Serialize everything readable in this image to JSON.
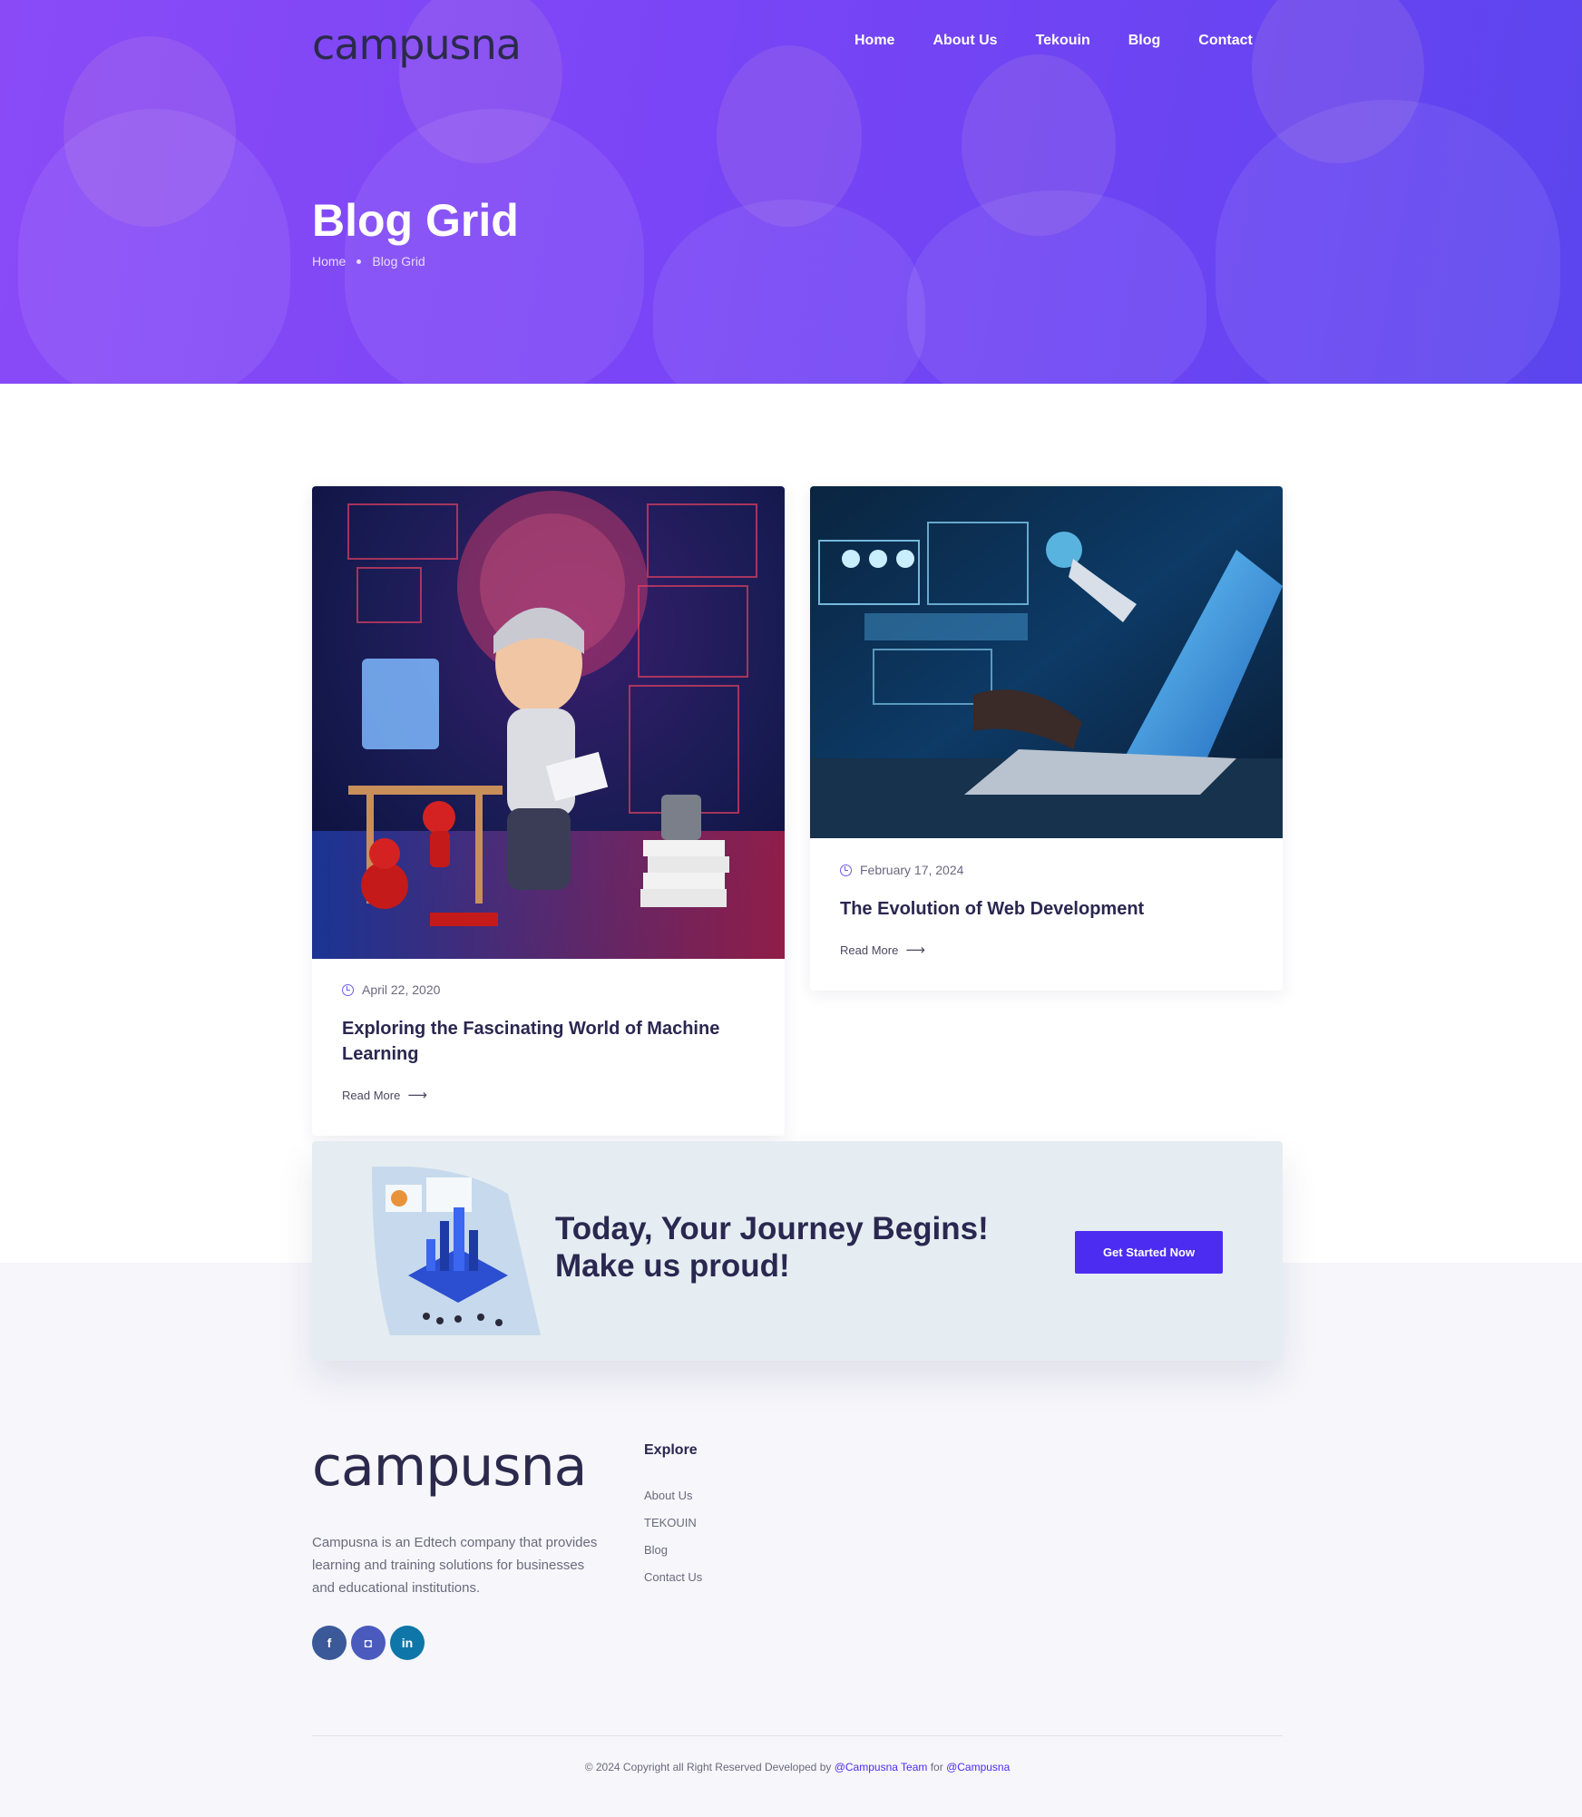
{
  "header": {
    "logo": "campusna",
    "nav": [
      "Home",
      "About Us",
      "Tekouin",
      "Blog",
      "Contact"
    ]
  },
  "hero": {
    "title": "Blog Grid",
    "breadcrumb": [
      "Home",
      "Blog Grid"
    ]
  },
  "posts": [
    {
      "date": "April 22, 2020",
      "title": "Exploring the Fascinating World of Machine Learning",
      "read_more": "Read More",
      "arrow": "⟶"
    },
    {
      "date": "February 17, 2024",
      "title": "The Evolution of Web Development",
      "read_more": "Read More",
      "arrow": "⟶"
    }
  ],
  "cta": {
    "headline_1": "Today, Your Journey Begins!",
    "headline_2": "Make us proud!",
    "button": "Get Started Now"
  },
  "footer": {
    "logo": "campusna",
    "description": "Campusna is an Edtech company that provides learning and training solutions for businesses and educational institutions.",
    "social": [
      {
        "label": "f",
        "icon": "facebook-icon",
        "color": "#3b5998"
      },
      {
        "label": "◘",
        "icon": "instagram-icon",
        "color": "#4a5bbd"
      },
      {
        "label": "in",
        "icon": "linkedin-icon",
        "color": "#0e76a8"
      }
    ],
    "explore": {
      "title": "Explore",
      "links": [
        "About Us",
        "TEKOUIN",
        "Blog",
        "Contact Us"
      ]
    },
    "copyright": {
      "prefix": "© 2024 Copyright all Right Reserved Developed by ",
      "team": "@Campusna Team",
      "middle": " for ",
      "brand": "@Campusna"
    }
  },
  "colors": {
    "accent": "#4d2cf2",
    "hero_start": "#8a4bf7",
    "hero_end": "#5b45ee",
    "heading": "#2a2750"
  }
}
